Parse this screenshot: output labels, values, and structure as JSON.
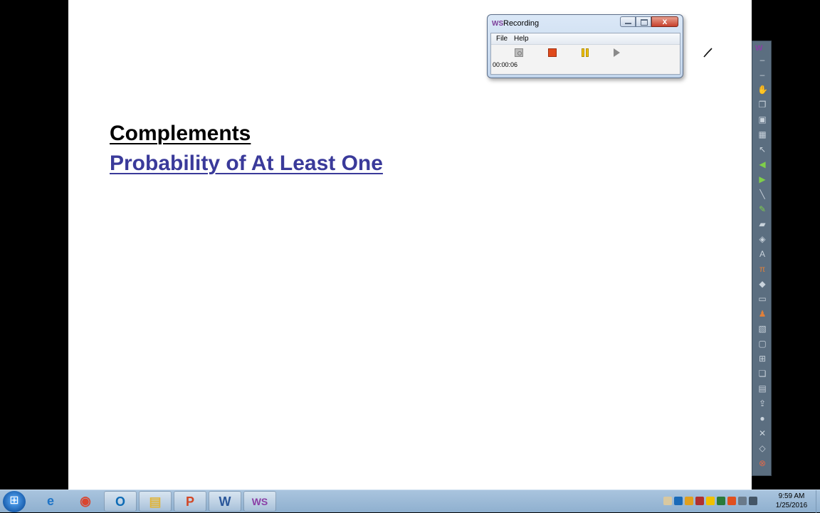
{
  "slide": {
    "heading": "Complements",
    "subheading": "Probability of At Least One",
    "subheading_color": "#3a3a9a"
  },
  "recording_window": {
    "logo": "WS",
    "title": "Recording",
    "menu": [
      "File",
      "Help"
    ],
    "timer": "00:00:06",
    "close_glyph": "x"
  },
  "toolbar": {
    "logo": "W",
    "icons": [
      "separator-icon",
      "separator-icon",
      "hand-icon",
      "pages-icon",
      "screenshot-icon",
      "snapshot-icon",
      "pointer-icon",
      "back-arrow-icon",
      "forward-arrow-icon",
      "line-icon",
      "pen-icon",
      "highlighter-icon",
      "eraser-icon",
      "text-icon",
      "formula-icon",
      "shapes-icon",
      "ruler-icon",
      "stamp-icon",
      "image-icon",
      "frame-icon",
      "insert-icon",
      "copy-icon",
      "paste-icon",
      "export-icon",
      "record-icon",
      "close-icon",
      "clear-icon",
      "power-icon"
    ]
  },
  "taskbar": {
    "apps": [
      {
        "name": "internet-explorer",
        "glyph": "e",
        "color": "#1e74c7"
      },
      {
        "name": "chrome",
        "glyph": "◉",
        "color": "#d9452f"
      },
      {
        "name": "outlook",
        "glyph": "O",
        "color": "#0d6bb5"
      },
      {
        "name": "file-explorer",
        "glyph": "▤",
        "color": "#e0b43a"
      },
      {
        "name": "powerpoint",
        "glyph": "P",
        "color": "#d24726"
      },
      {
        "name": "word",
        "glyph": "W",
        "color": "#2b579a"
      },
      {
        "name": "webex-screen",
        "glyph": "WS",
        "color": "#8b3fa6"
      }
    ],
    "clock_time": "9:59 AM",
    "clock_date": "1/25/2016"
  }
}
